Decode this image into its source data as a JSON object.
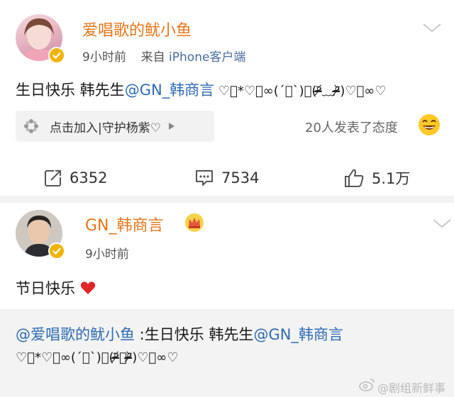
{
  "post": {
    "author_name": "爱唱歌的鱿小鱼",
    "time": "9小时前",
    "source_prefix": "来自",
    "source": "iPhone客户端",
    "content_text": "生日快乐 韩先生",
    "content_mention": "@GN_韩商言",
    "content_kaomoji": " ♡ᷤ*♡ᷤ∞(ˊ﹀ˋ)⌒(ᵒ̴̶̷᷄﹏ᵒ̴̶̷᷅)♡ᷤ∞♡",
    "topic_label": "点击加入|守护杨紫♡",
    "reaction_text": "20人发表了态度",
    "actions": {
      "repost_count": "6352",
      "comment_count": "7534",
      "like_count": "5.1万"
    }
  },
  "reply": {
    "author_name": "GN_韩商言",
    "time": "9小时前",
    "content_text": "节日快乐",
    "quote_mention": "@爱唱歌的鱿小鱼",
    "quote_text": " :生日快乐 韩先生",
    "quote_mention2": "@GN_韩商言",
    "quote_kaomoji": "♡ᷤ*♡ᷤ∞(ˊ﹀ˋ)⌒(ᵒ̴̶̷᷄﹏ᵒ̴̶̷᷅)♡ᷤ∞♡"
  },
  "watermark": "@剧组新鲜事",
  "colors": {
    "accent_name": "#e5761b",
    "mention": "#2f6bb5",
    "verified": "#f0b400",
    "heart": "#e0232b"
  },
  "icons": [
    "chevron-down-icon",
    "verified-badge-icon",
    "topic-pinwheel-icon",
    "play-triangle-icon",
    "laughing-emoji-icon",
    "repost-icon",
    "comment-icon",
    "like-icon",
    "crown-badge-icon",
    "heart-emoji-icon",
    "weibo-logo-icon"
  ]
}
